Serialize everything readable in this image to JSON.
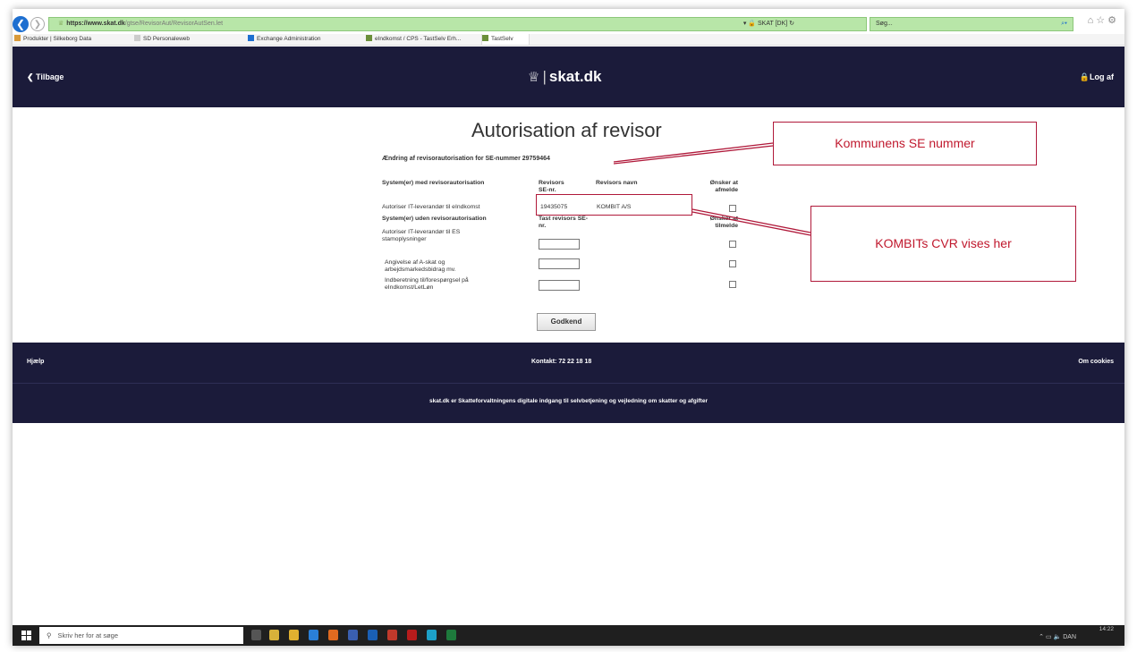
{
  "browser": {
    "url_host": "https://www.skat.dk",
    "url_path": "/gtse/RevisorAut/RevisorAutSen.let",
    "site_label": "▾ 🔒 SKAT [DK] ↻",
    "search_placeholder": "Søg...",
    "tabs": [
      {
        "label": "Produkter | Silkeborg Data"
      },
      {
        "label": "SD Personaleweb"
      },
      {
        "label": "Exchange Administration"
      },
      {
        "label": "eIndkomst / CPS - TastSelv Erh..."
      },
      {
        "label": "TastSelv"
      }
    ]
  },
  "header": {
    "back_label": "Tilbage",
    "logo_text": "skat.dk",
    "logout_label": "Log af"
  },
  "main": {
    "title": "Autorisation af revisor",
    "subtitle": "Ændring af revisorautorisation for SE-nummer 29759464",
    "section_with": {
      "heading": "System(er) med revisorautorisation",
      "col_se": "Revisors SE-nr.",
      "col_name": "Revisors navn",
      "col_unsub": "Ønsker at afmelde",
      "rows": [
        {
          "label": "Autoriser IT-leverandør til eIndkomst",
          "se": "19435075",
          "name": "KOMBIT A/S"
        }
      ]
    },
    "section_without": {
      "heading": "System(er) uden revisorautorisation",
      "col_se": "Tast revisors SE-nr.",
      "col_sub": "Ønsker at tilmelde",
      "rows": [
        {
          "label": "Autoriser IT-leverandør til ES stamoplysninger"
        },
        {
          "label": "Angivelse af A-skat og arbejdsmarkedsbidrag mv."
        },
        {
          "label": "Indberetning til/forespørgsel på eIndkomst/LetLøn"
        }
      ]
    },
    "submit_label": "Godkend"
  },
  "annotations": {
    "se_callout": "Kommunens SE nummer",
    "cvr_callout": "KOMBITs CVR vises her"
  },
  "footer": {
    "help": "Hjælp",
    "contact": "Kontakt: 72 22 18 18",
    "cookies": "Om cookies",
    "tagline": "skat.dk er Skatteforvaltningens digitale indgang til selvbetjening og vejledning om skatter og afgifter"
  },
  "taskbar": {
    "search_placeholder": "Skriv her for at søge",
    "lang": "DAN",
    "time": "14:22"
  },
  "colors": {
    "navy": "#1b1b3a",
    "annotation_red": "#b0193a",
    "address_green": "#b8e6a8"
  }
}
